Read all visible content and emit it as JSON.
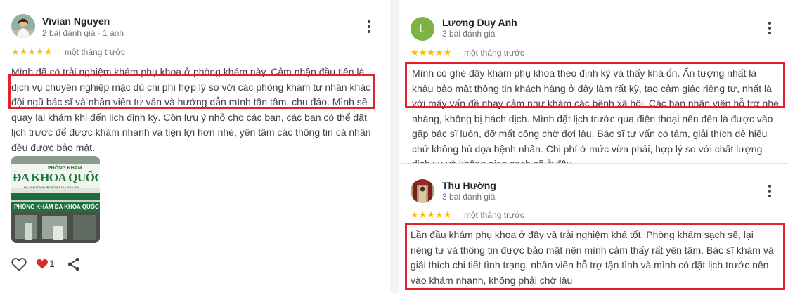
{
  "reviews": [
    {
      "name": "Vivian Nguyen",
      "meta": "2 bài đánh giá · 1 ảnh",
      "stars": "★★★★★",
      "date": "một tháng trước",
      "lines": [
        "Mình đã có trải nghiệm khám phụ khoa ở phòng khám này. Cảm nhận đầu tiên là",
        "dịch vụ chuyên nghiệp mặc dù chi phí hợp lý so với các phòng khám tư nhân khác",
        "đội ngũ bác sĩ và nhân viên tư vấn và hướng dẫn mình tận tâm, chu đáo. Mình sẽ",
        "quay lại khám khi đến lịch định kỳ. Còn lưu ý nhỏ cho các bạn, các bạn có thể đặt",
        "lịch trước để được khám nhanh và tiện lợi hơn nhé, yên tâm các thông tin cá nhân",
        "đều được bảo mật."
      ],
      "photo_sign": {
        "small": "PHÒNG KHÁM",
        "big": "ĐA KHOA QUỐC TẾ",
        "address": "ĐC 14 ĐƯỜNG LIỆU ĐỒNG 1B · P.HÀ NỘI",
        "lower": "PHÒNG KHÁM ĐA KHOA QUỐC"
      },
      "like_count": "1"
    },
    {
      "name": "Lương Duy Anh",
      "avatar_letter": "L",
      "meta": "3 bài đánh giá",
      "stars": "★★★★★",
      "date": "một tháng trước",
      "lines": [
        "Mình có ghé đây khám phụ khoa theo định kỳ và thấy khá ổn. Ấn tượng nhất là",
        "khâu bảo mật thông tin khách hàng ở đây làm rất kỹ, tạo cảm giác riêng tư, nhất là",
        "với mấy vấn đề nhạy cảm như khám các bệnh xã hội. Các bạn nhân viên hỗ trợ nhẹ",
        "nhàng, không bị hách dịch. Mình đặt lịch trước qua điện thoại nên đến là được vào",
        "gặp bác sĩ luôn, đỡ mất công chờ đợi lâu. Bác sĩ tư vấn có tâm, giải thích dễ hiểu",
        "chứ không hù dọa bệnh nhân. Chi phí ở mức vừa phải, hợp lý so với chất lượng",
        "dịch vụ và không gian sạch sẽ ở đây"
      ]
    },
    {
      "name": "Thu Hường",
      "meta": "3 bài đánh giá",
      "stars": "★★★★★",
      "date": "một tháng trước",
      "lines": [
        "Lần đầu khám phụ khoa ở đây và trải nghiệm khá tốt. Phòng khám sạch sẽ, lại",
        "riêng tư và thông tin được bảo mật nên mình cảm thấy rất yên tâm. Bác sĩ khám và",
        "giải thích chi tiết tình trạng, nhân viên hỗ trợ tận tình và mình có đặt lịch trước nên",
        "vào khám nhanh, không phải chờ lâu"
      ]
    }
  ],
  "colors": {
    "star": "#fbbc04",
    "highlight": "#e8202a",
    "avatar_green": "#7cb342",
    "like_red": "#d93025"
  },
  "icons": [
    "more-vert-icon",
    "heart-outline-icon",
    "heart-filled-icon",
    "share-icon",
    "star-icon"
  ]
}
